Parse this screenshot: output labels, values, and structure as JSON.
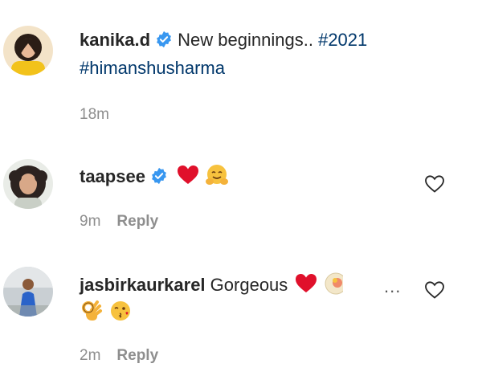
{
  "caption": {
    "username": "kanika.d",
    "text": "New beginnings..",
    "hashtag1": "#2021",
    "hashtag2": "#himanshusharma",
    "time": "18m"
  },
  "comments": [
    {
      "username": "taapsee",
      "emojis": [
        "red-heart",
        "hugging-face"
      ],
      "time": "9m",
      "reply_label": "Reply"
    },
    {
      "username": "jasbirkaurkarel",
      "text": "Gorgeous",
      "emojis": [
        "red-heart",
        "face-partially-visible",
        "ok-hand",
        "face-blowing-kiss"
      ],
      "time": "2m",
      "reply_label": "Reply",
      "more_label": "..."
    }
  ],
  "colors": {
    "text": "#262626",
    "muted": "#8e8e8e",
    "hashtag": "#00376b",
    "verified": "#3897f0",
    "heart": "#e0102b"
  },
  "icons": {
    "verified": "verified-badge-icon",
    "like": "heart-outline-icon"
  }
}
